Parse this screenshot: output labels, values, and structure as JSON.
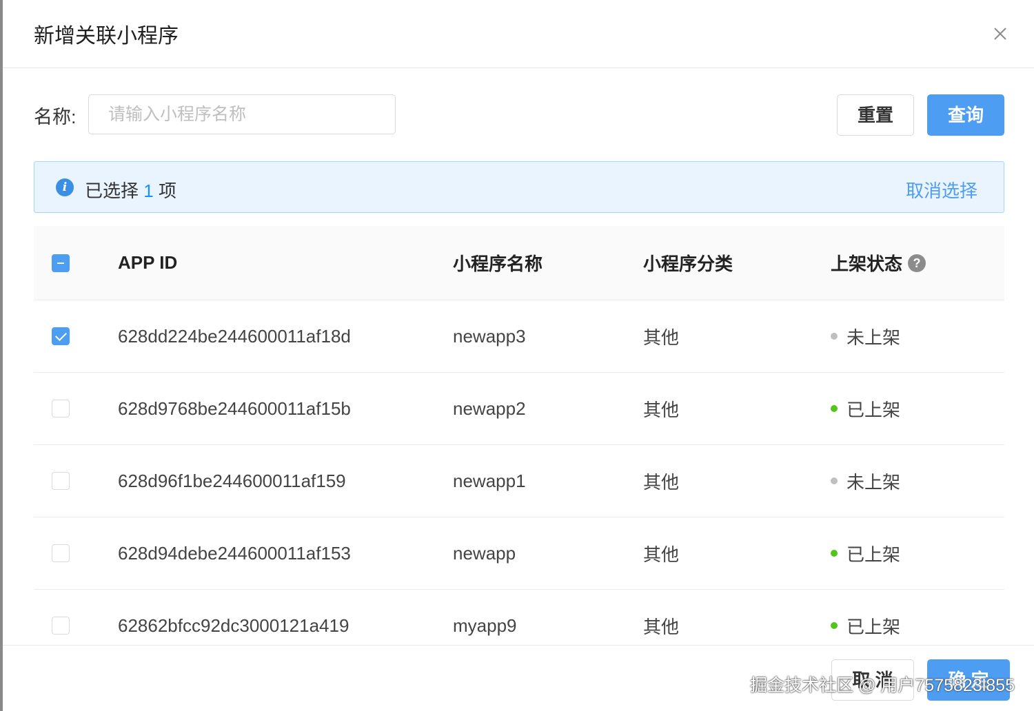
{
  "modal": {
    "title": "新增关联小程序"
  },
  "search": {
    "label": "名称:",
    "placeholder": "请输入小程序名称",
    "value": ""
  },
  "buttons": {
    "reset": "重置",
    "query": "查询",
    "cancel": "取 消",
    "ok": "确 定"
  },
  "alert": {
    "prefix": "已选择",
    "count": "1",
    "suffix": "项",
    "clear": "取消选择"
  },
  "table": {
    "headers": {
      "app_id": "APP ID",
      "name": "小程序名称",
      "category": "小程序分类",
      "status": "上架状态"
    },
    "rows": [
      {
        "app_id": "628dd224be244600011af18d",
        "name": "newapp3",
        "category": "其他",
        "status": "未上架",
        "checked": true
      },
      {
        "app_id": "628d9768be244600011af15b",
        "name": "newapp2",
        "category": "其他",
        "status": "已上架",
        "checked": false
      },
      {
        "app_id": "628d96f1be244600011af159",
        "name": "newapp1",
        "category": "其他",
        "status": "未上架",
        "checked": false
      },
      {
        "app_id": "628d94debe244600011af153",
        "name": "newapp",
        "category": "其他",
        "status": "已上架",
        "checked": false
      },
      {
        "app_id": "62862bfcc92dc3000121a419",
        "name": "myapp9",
        "category": "其他",
        "status": "已上架",
        "checked": false
      }
    ]
  },
  "colors": {
    "primary": "#4d9df2",
    "online": "#52c41a",
    "offline": "#bfbfbf"
  },
  "watermark": "掘金技术社区 @ 用户7575823l855"
}
